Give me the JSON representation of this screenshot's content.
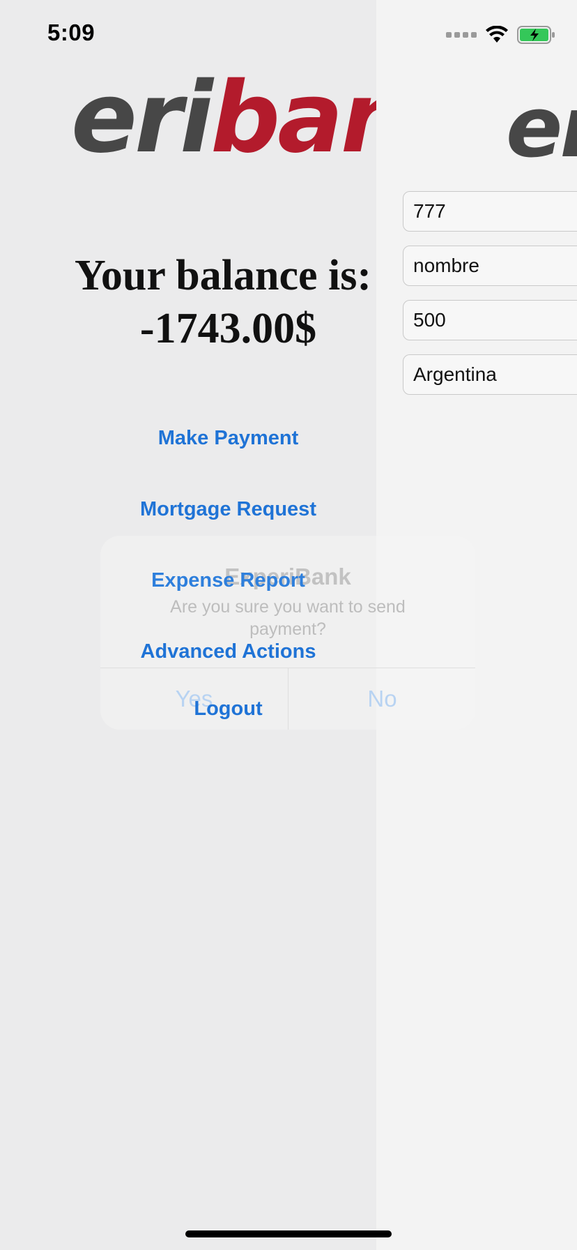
{
  "status_bar": {
    "time": "5:09"
  },
  "home": {
    "logo_dark": "eri",
    "logo_red": "bank",
    "balance_label": "Your balance is:",
    "balance_amount": "-1743.00$",
    "menu": {
      "make_payment": "Make Payment",
      "mortgage_request": "Mortgage Request",
      "expense_report": "Expense Report",
      "advanced_actions": "Advanced Actions",
      "logout": "Logout"
    }
  },
  "payment": {
    "logo_partial": "er",
    "fields": {
      "phone": "777",
      "name": "nombre",
      "amount": "500",
      "country": "Argentina"
    }
  },
  "alert": {
    "title": "ExperiBank",
    "message": "Are you sure you want to send payment?",
    "yes_label": "Yes",
    "no_label": "No"
  },
  "colors": {
    "accent": "#1f73d6",
    "brand_red": "#b31b2c",
    "brand_gray": "#474747",
    "battery_green": "#34c759"
  },
  "icons": [
    "wifi-icon",
    "battery-charging-icon",
    "signal-icon"
  ]
}
